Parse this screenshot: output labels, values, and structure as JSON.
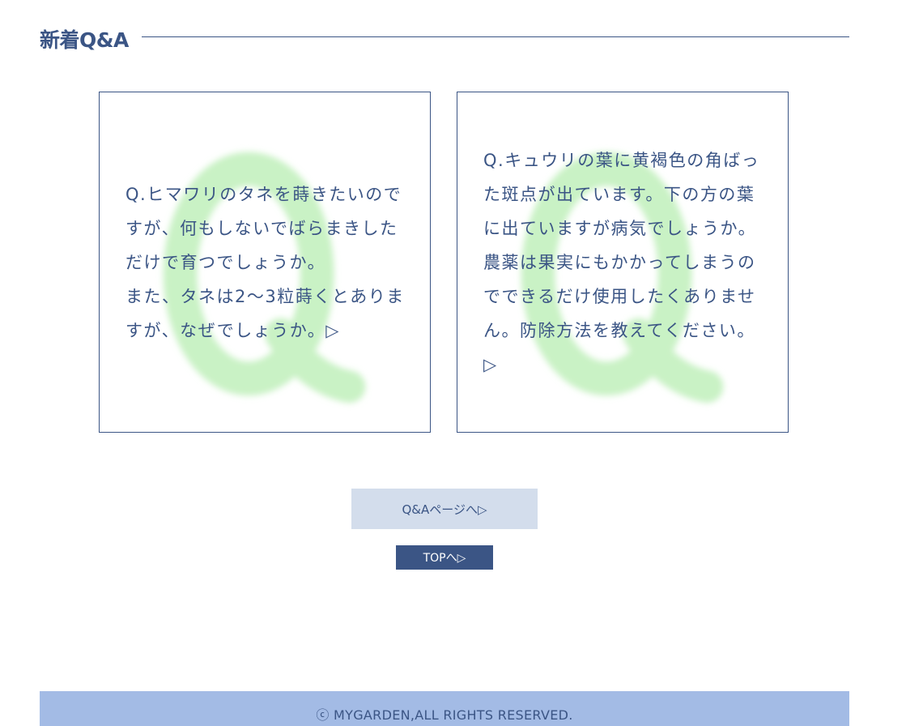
{
  "section": {
    "title": "新着Q&A"
  },
  "questions": [
    {
      "text": "Q.ヒマワリのタネを蒔きたいのですが、何もしないでばらまきしただけで育つでしょうか。\nまた、タネは2～3粒蒔くとありますが、なぜでしょうか。▷"
    },
    {
      "text": "Q.キュウリの葉に黄褐色の角ばった斑点が出ています。下の方の葉に出ていますが病気でしょうか。農薬は果実にもかかってしまうのでできるだけ使用したくありません。防除方法を教えてください。▷"
    }
  ],
  "buttons": {
    "qa_page": "Q&Aページへ▷",
    "top": "TOPへ▷"
  },
  "footer": {
    "copyright": "ⓒ MYGARDEN,ALL RIGHTS RESERVED."
  },
  "colors": {
    "primary": "#3b5585",
    "button_light": "#d3ddec",
    "footer_bg": "#a3bbe5",
    "q_mark": "#c9f2c5"
  }
}
